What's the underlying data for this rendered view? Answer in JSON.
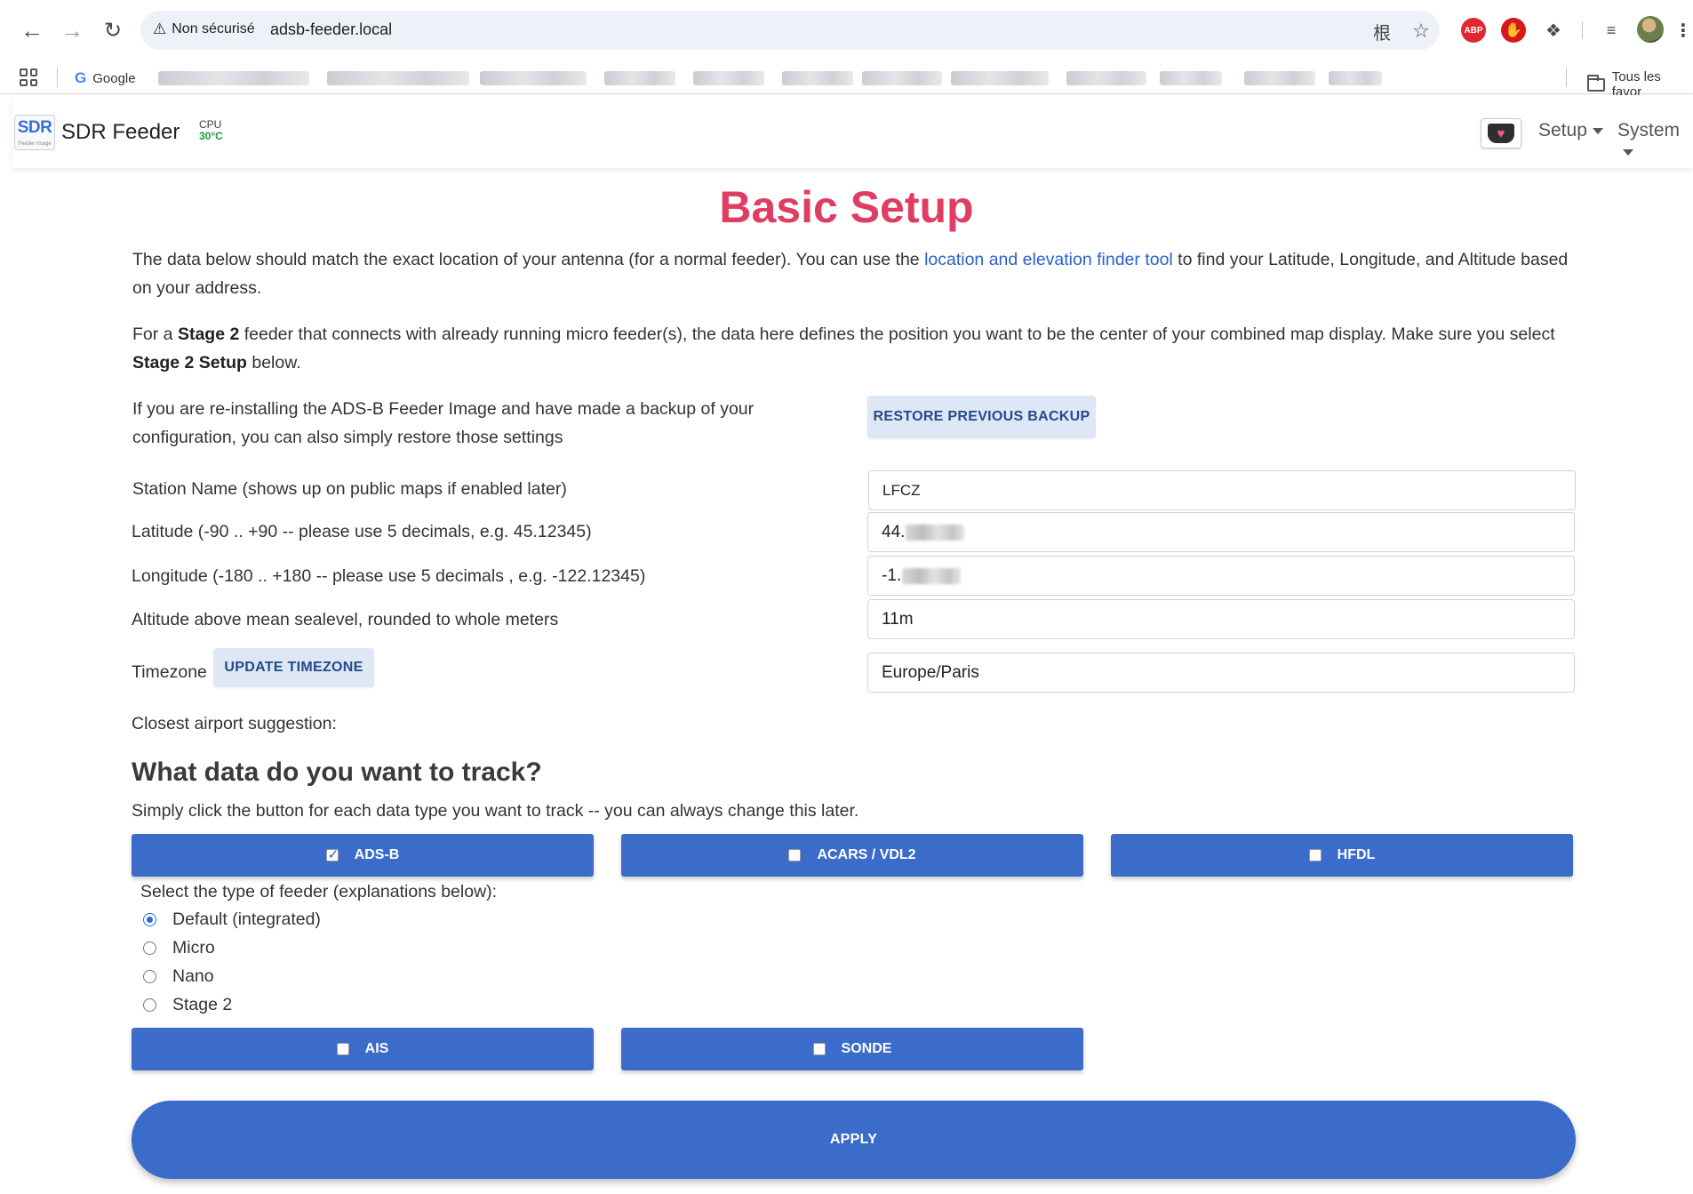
{
  "browser": {
    "security_label": "Non sécurisé",
    "url": "adsb-feeder.local",
    "bookmarks": {
      "google_label": "Google",
      "all_bookmarks_label": "Tous les favor"
    },
    "extensions": {
      "abp_label": "ABP"
    }
  },
  "app": {
    "logo_text": "SDR",
    "logo_subtext": "Feeder Image",
    "brand": "SDR Feeder",
    "cpu_label": "CPU",
    "cpu_temp": "30°C",
    "menu_setup": "Setup",
    "menu_system": "System"
  },
  "page": {
    "title": "Basic Setup",
    "intro_before_link": "The data below should match the exact location of your antenna (for a normal feeder). You can use the ",
    "intro_link": "location and elevation finder tool",
    "intro_after_link": " to find your Latitude, Longitude, and Altitude based on your address.",
    "stage2_p1": "For a ",
    "stage2_bold1": "Stage 2",
    "stage2_p2": " feeder that connects with already running micro feeder(s), the data here defines the position you want to be the center of your combined map display. Make sure you select ",
    "stage2_bold2": "Stage 2 Setup",
    "stage2_p3": " below.",
    "restore_text": "If you are re-installing the ADS-B Feeder Image and have made a backup of your configuration, you can also simply restore those settings",
    "restore_button": "RESTORE PREVIOUS BACKUP"
  },
  "form": {
    "station_name_label": "Station Name (shows up on public maps if enabled later)",
    "station_name_value": "LFCZ",
    "latitude_label": "Latitude (-90 .. +90 -- please use 5 decimals, e.g. 45.12345)",
    "latitude_value_prefix": "44.",
    "longitude_label": "Longitude (-180 .. +180 -- please use 5 decimals , e.g. -122.12345)",
    "longitude_value_prefix": "-1.",
    "altitude_label": "Altitude above mean sealevel, rounded to whole meters",
    "altitude_value": "11m",
    "timezone_label": "Timezone",
    "update_timezone_button": "UPDATE TIMEZONE",
    "timezone_value": "Europe/Paris",
    "closest_airport_label": "Closest airport suggestion:"
  },
  "track": {
    "heading": "What data do you want to track?",
    "subtext": "Simply click the button for each data type you want to track -- you can always change this later.",
    "buttons": [
      {
        "label": "ADS-B",
        "checked": true
      },
      {
        "label": "ACARS / VDL2",
        "checked": false
      },
      {
        "label": "HFDL",
        "checked": false
      },
      {
        "label": "AIS",
        "checked": false
      },
      {
        "label": "SONDE",
        "checked": false
      }
    ],
    "feeder_type_label": "Select the type of feeder (explanations below):",
    "feeder_types": [
      {
        "label": "Default (integrated)",
        "selected": true
      },
      {
        "label": "Micro",
        "selected": false
      },
      {
        "label": "Nano",
        "selected": false
      },
      {
        "label": "Stage 2",
        "selected": false
      }
    ],
    "apply_button": "APPLY"
  },
  "colors": {
    "title": "#df3e62",
    "primary": "#3b6cc9",
    "link": "#2a62c9",
    "light_button": "#dde7f6"
  }
}
